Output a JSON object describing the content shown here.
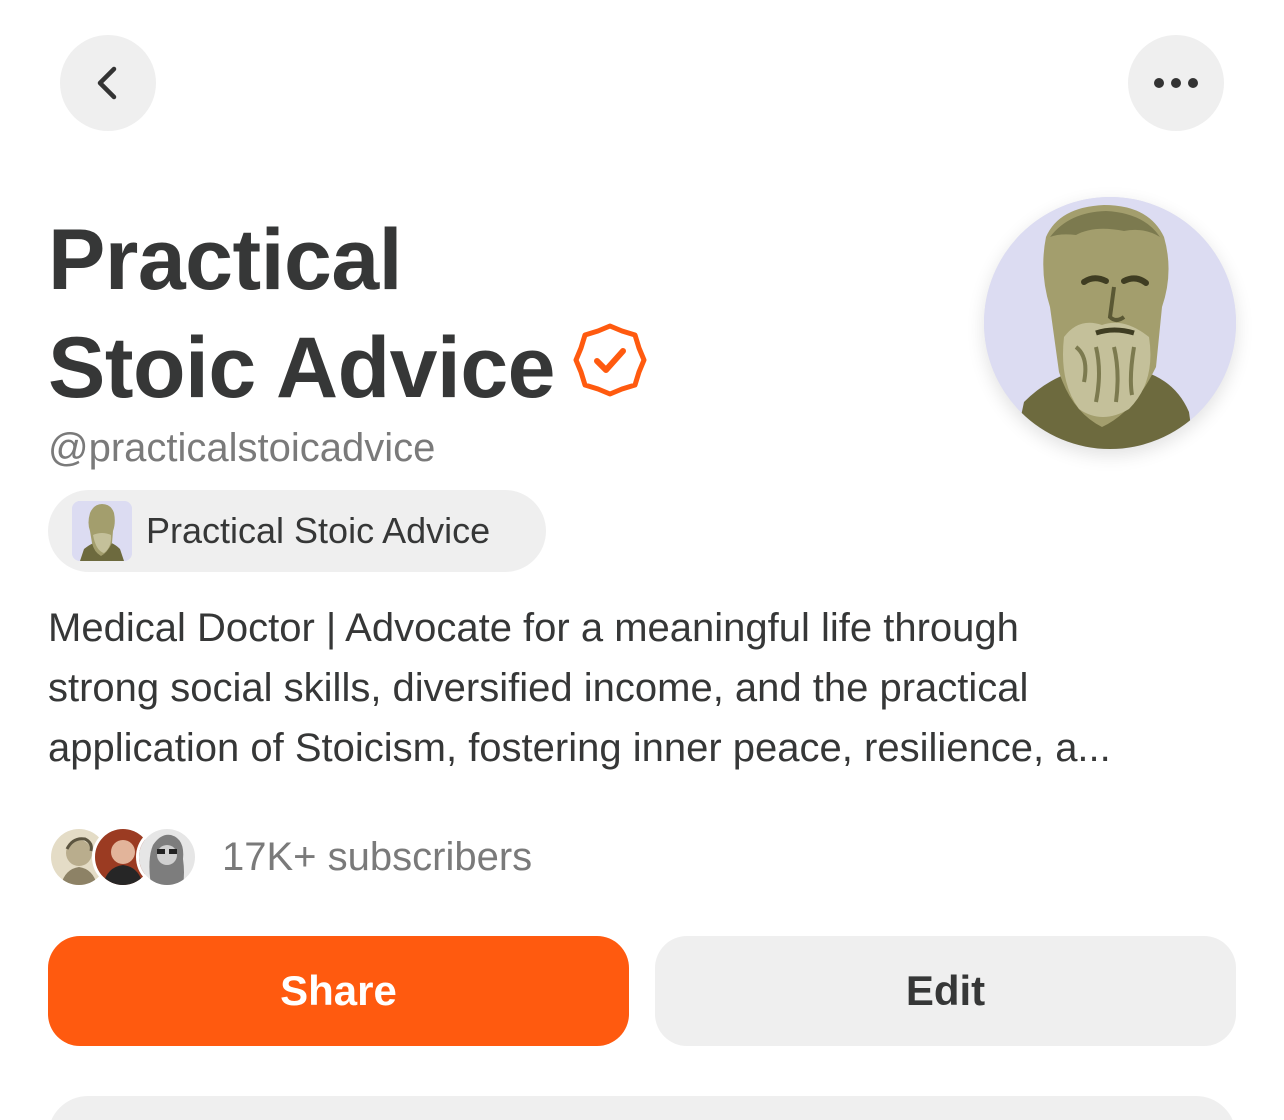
{
  "nav": {
    "back_icon": "chevron-left-icon",
    "more_icon": "ellipsis-horizontal-icon"
  },
  "profile": {
    "title_line1": "Practical",
    "title_line2": "Stoic Advice",
    "verified_icon": "verified-badge-icon",
    "handle": "@practicalstoicadvice",
    "avatar_icon": "stoic-bust-avatar",
    "publication": {
      "label": "Practical Stoic Advice",
      "thumb_icon": "stoic-bust-thumbnail"
    },
    "bio_lines": [
      "Medical Doctor | Advocate for a meaningful life through",
      "strong social skills, diversified income, and the practical",
      "application of Stoicism, fostering inner peace, resilience, a..."
    ],
    "subscribers_label": "17K+ subscribers"
  },
  "actions": {
    "share_label": "Share",
    "edit_label": "Edit"
  },
  "colors": {
    "accent": "#ff5a0f",
    "button_gray": "#efefef",
    "text_dark": "#363737",
    "text_muted": "#7a7a7a"
  }
}
